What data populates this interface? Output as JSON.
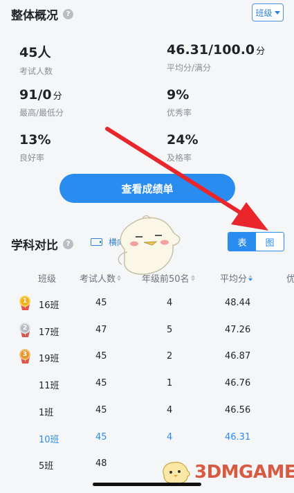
{
  "overview": {
    "title": "整体概况",
    "help_glyph": "?",
    "class_select": "班级",
    "stats": [
      {
        "value": "45人",
        "unit": "",
        "label": "考试人数"
      },
      {
        "value": "46.31/100.0",
        "unit": "分",
        "label": "平均分/满分"
      },
      {
        "value": "91/0",
        "unit": "分",
        "label": "最高/最低分"
      },
      {
        "value": "9%",
        "unit": "",
        "label": "优秀率"
      },
      {
        "value": "13%",
        "unit": "",
        "label": "良好率"
      },
      {
        "value": "24%",
        "unit": "",
        "label": "及格率"
      }
    ],
    "report_button": "查看成绩单"
  },
  "subject": {
    "title": "学科对比",
    "landscape_label": "横向",
    "toggle": {
      "table": "表",
      "chart": "图",
      "selected": "表"
    },
    "columns": [
      "班级",
      "考试人数",
      "年级前50名",
      "平均分",
      "优"
    ],
    "sorted_column": "平均分",
    "rows": [
      {
        "class": "16班",
        "count": "45",
        "top50": "4",
        "avg": "48.44",
        "medal": "1",
        "highlight": false
      },
      {
        "class": "17班",
        "count": "47",
        "top50": "5",
        "avg": "47.26",
        "medal": "2",
        "highlight": false
      },
      {
        "class": "19班",
        "count": "45",
        "top50": "2",
        "avg": "46.87",
        "medal": "3",
        "highlight": false
      },
      {
        "class": "11班",
        "count": "45",
        "top50": "1",
        "avg": "46.76",
        "medal": "",
        "highlight": false
      },
      {
        "class": "1班",
        "count": "45",
        "top50": "4",
        "avg": "46.56",
        "medal": "",
        "highlight": false
      },
      {
        "class": "10班",
        "count": "45",
        "top50": "4",
        "avg": "46.31",
        "medal": "",
        "highlight": true
      },
      {
        "class": "5班",
        "count": "48",
        "top50": "",
        "avg": "",
        "medal": "",
        "highlight": false
      }
    ]
  },
  "watermark": "3DMGAME",
  "colors": {
    "accent": "#2b8cf0",
    "arrow": "#e8262b",
    "watermark": "#d44b2f"
  }
}
